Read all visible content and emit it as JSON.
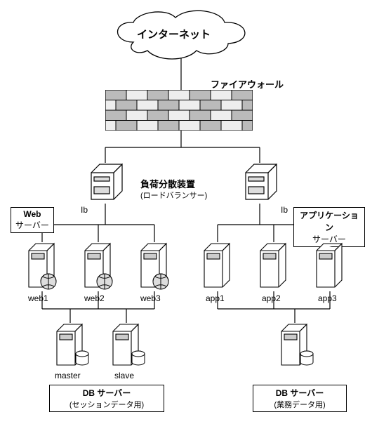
{
  "cloud": {
    "label": "インターネット"
  },
  "firewall": {
    "label": "ファイアウォール"
  },
  "lb": {
    "title": "負荷分散装置",
    "subtitle": "(ロードバランサー)",
    "left_id": "Ib",
    "right_id": "Ib"
  },
  "web": {
    "group_title": "Web",
    "group_sub": "サーバー",
    "nodes": [
      "web1",
      "web2",
      "web3"
    ]
  },
  "app": {
    "group_title": "アプリケーション",
    "group_sub": "サーバー",
    "nodes": [
      "app1",
      "app2",
      "app3"
    ]
  },
  "db_session": {
    "group_title": "DB サーバー",
    "group_sub": "(セッションデータ用)",
    "nodes": [
      "master",
      "slave"
    ]
  },
  "db_business": {
    "group_title": "DB サーバー",
    "group_sub": "(業務データ用)"
  }
}
